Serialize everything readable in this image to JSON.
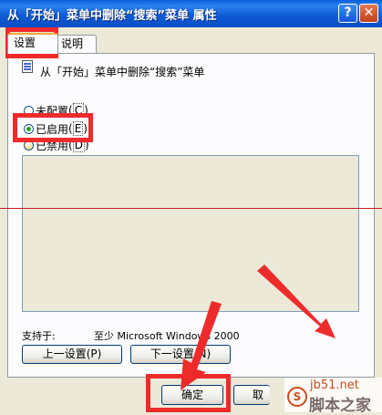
{
  "window": {
    "title": "从「开始」菜单中删除“搜索”菜单 属性",
    "help_glyph": "?",
    "close_glyph": "✕"
  },
  "tabs": [
    {
      "label": "设置",
      "selected": true
    },
    {
      "label": "说明",
      "selected": false
    }
  ],
  "policy": {
    "icon": "policy-document-icon",
    "name": "从「开始」菜单中删除“搜索”菜单"
  },
  "options": [
    {
      "label": "未配置",
      "hotkey": "C",
      "checked": false
    },
    {
      "label": "已启用",
      "hotkey": "E",
      "checked": true
    },
    {
      "label": "已禁用",
      "hotkey": "D",
      "checked": false
    }
  ],
  "supported": {
    "label": "支持于:",
    "value": "至少 Microsoft Windows 2000"
  },
  "buttons": {
    "prev": "上一设置(P)",
    "next": "下一设置(N)",
    "ok": "确定",
    "cancel_partial": "取"
  },
  "watermark": {
    "site": "jb51.net",
    "name": "脚本之家"
  },
  "colors": {
    "title_bar": "#0a5fd8",
    "highlight": "#ee2b2b",
    "dialog_bg": "#ece9d8",
    "radio_checked": "#21a121"
  }
}
